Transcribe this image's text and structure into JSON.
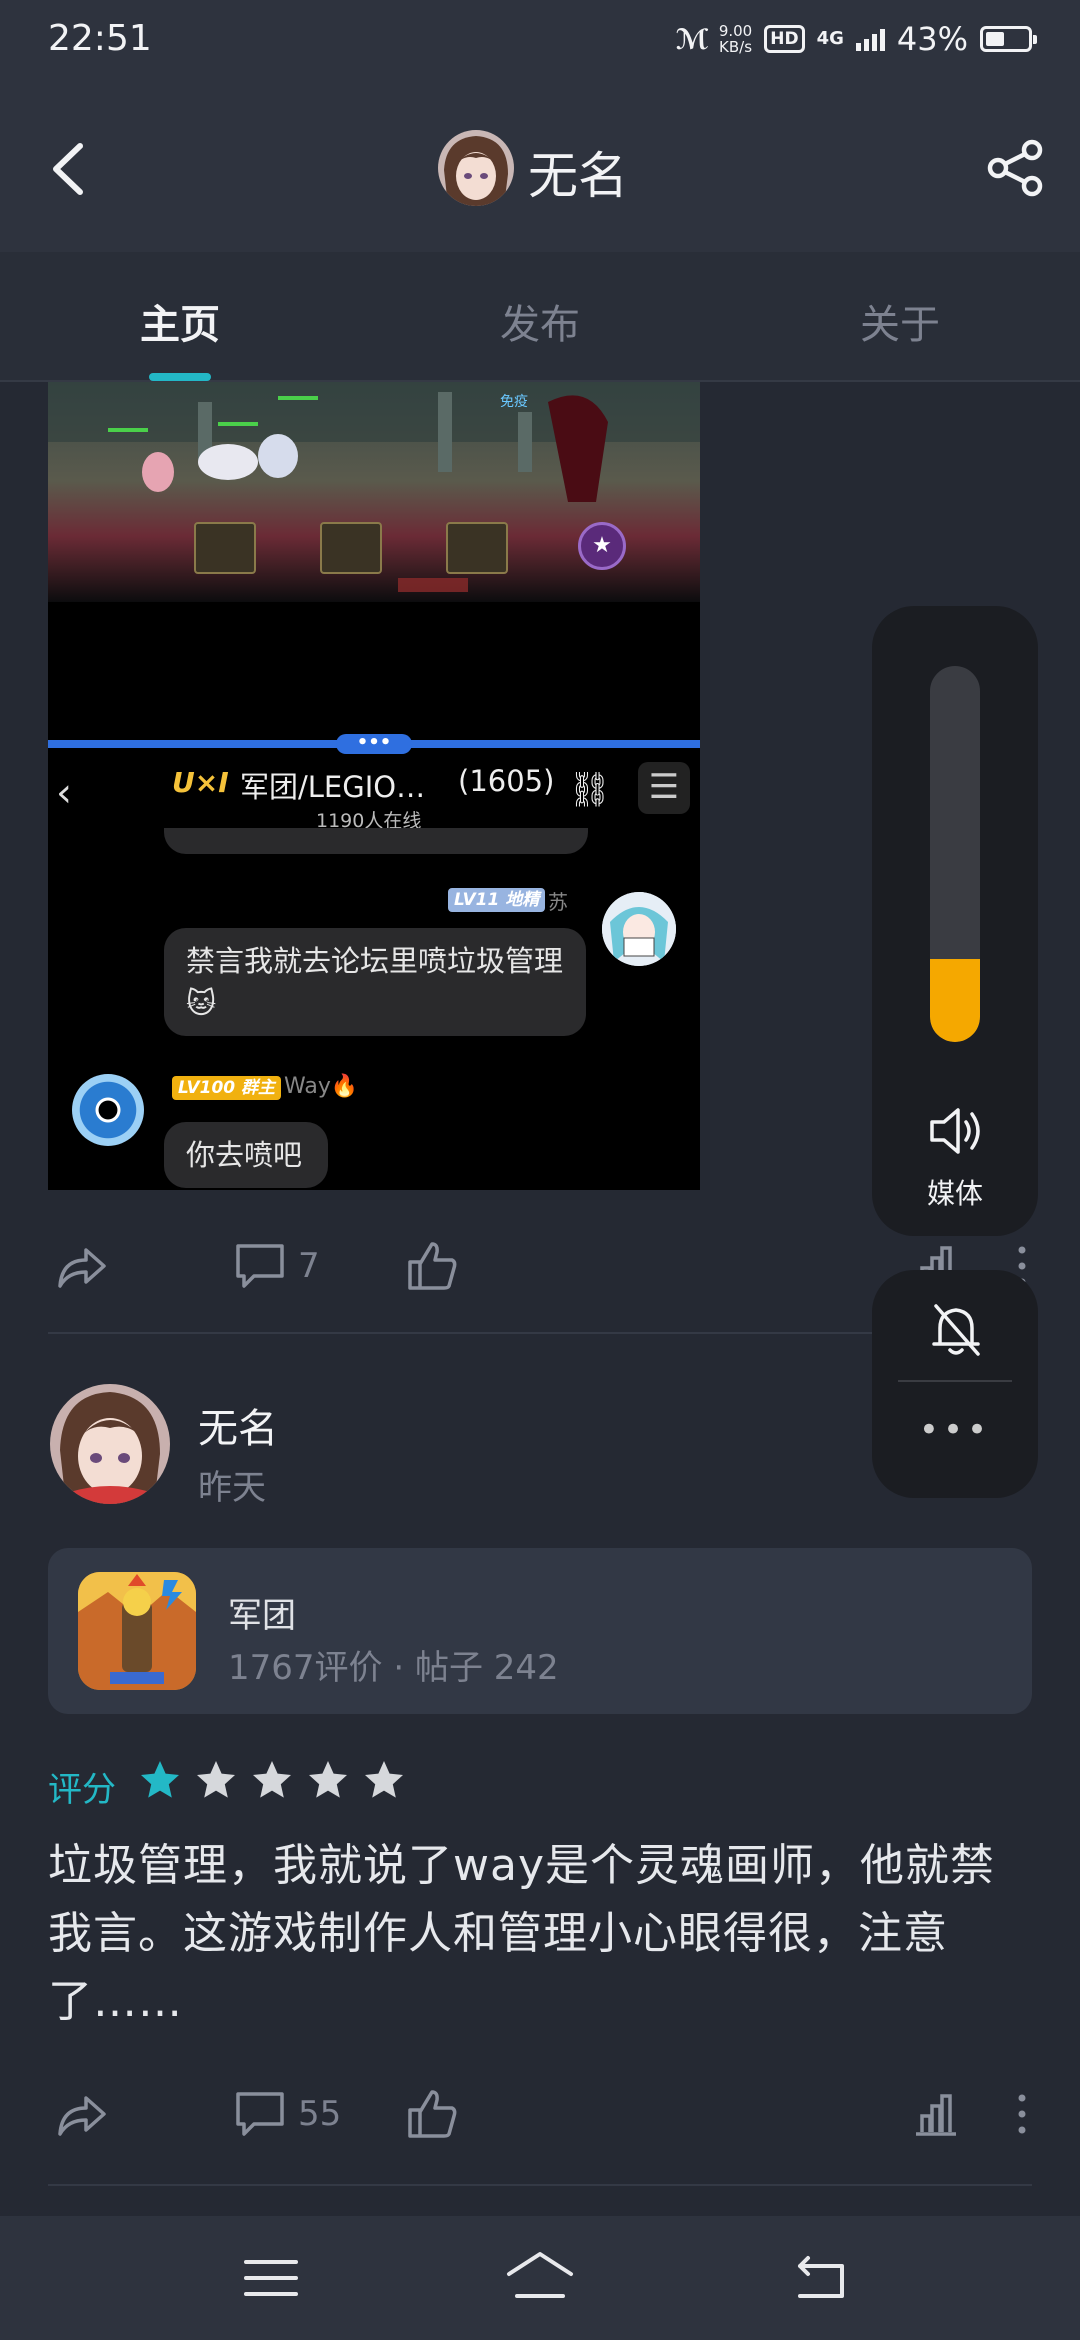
{
  "status_bar": {
    "time": "22:51",
    "carrier_icon": "signal-logo-icon",
    "net_speed": "9.00",
    "net_speed_unit": "KB/s",
    "hd": "HD",
    "network": "4G",
    "battery": "43%"
  },
  "header": {
    "title": "无名"
  },
  "tabs": [
    {
      "label": "主页"
    },
    {
      "label": "发布"
    },
    {
      "label": "关于"
    }
  ],
  "post1": {
    "embedded_chat": {
      "logo": "U×I",
      "group_title": "军团/LEGIO…",
      "count": "(1605)",
      "online": "1190人在线",
      "messages": [
        {
          "badge": "LV11 地精",
          "name": "苏",
          "text": "禁言我就去论坛里喷垃圾管理🐱"
        },
        {
          "badge": "LV100 群主",
          "name": "Way🔥",
          "text": "你去喷吧"
        }
      ]
    },
    "comment_count": "7"
  },
  "post2": {
    "author": "无名",
    "time": "昨天",
    "game": {
      "name": "军团",
      "stats": "1767评价 · 帖子 242"
    },
    "rating_label": "评分",
    "rating": 1,
    "rating_max": 5,
    "text": "垃圾管理，我就说了way是个灵魂画师，他就禁我言。这游戏制作人和管理小心眼得很，注意了……",
    "comment_count": "55"
  },
  "volume_panel": {
    "level": 0.22,
    "label": "媒体",
    "more": "•••"
  },
  "colors": {
    "accent": "#23b8c6",
    "volume": "#f5a800",
    "background": "#252933"
  }
}
